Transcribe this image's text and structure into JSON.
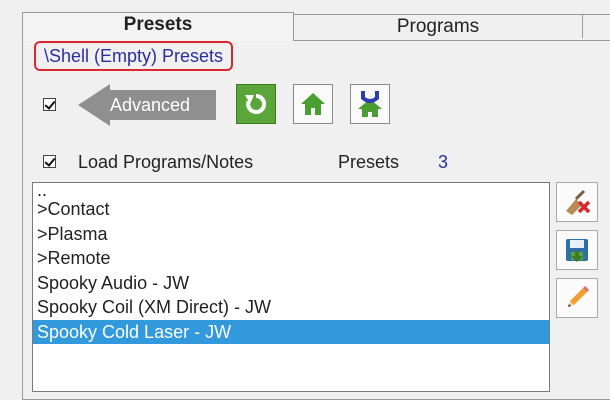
{
  "tabs": [
    {
      "label": "Presets",
      "active": true
    },
    {
      "label": "Programs",
      "active": false
    },
    {
      "label": "",
      "active": false
    }
  ],
  "group": {
    "title": "\\Shell (Empty) Presets"
  },
  "advanced": {
    "label": "Advanced",
    "checked": true
  },
  "toolbar": {
    "buttons": [
      "refresh-icon",
      "home-icon",
      "home-up-icon"
    ]
  },
  "load": {
    "label": "Load Programs/Notes",
    "checked": true
  },
  "presets": {
    "label": "Presets",
    "count": "3"
  },
  "list": {
    "items": [
      "..",
      ">Contact",
      ">Plasma",
      ">Remote",
      "Spooky Audio - JW",
      "Spooky Coil (XM Direct) - JW",
      "Spooky Cold Laser - JW"
    ],
    "selected_index": 6
  },
  "side_buttons": [
    "clear-icon",
    "save-icon",
    "edit-icon"
  ],
  "colors": {
    "accent": "#3399dd",
    "title_border": "#d9272e",
    "title_text": "#2a2e9e",
    "green": "#5aa63a"
  }
}
